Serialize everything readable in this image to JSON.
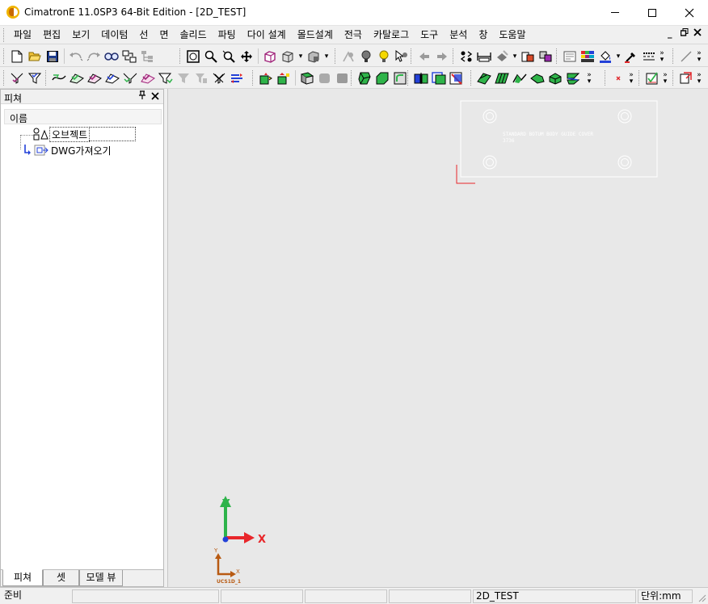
{
  "window": {
    "title": "CimatronE 11.0SP3 64-Bit Edition - [2D_TEST]",
    "controls": [
      "minimize",
      "maximize",
      "close"
    ]
  },
  "menu": {
    "items": [
      "파일",
      "편집",
      "보기",
      "데이텀",
      "선",
      "면",
      "솔리드",
      "파팅",
      "다이 설계",
      "몰드설계",
      "전극",
      "카탈로그",
      "도구",
      "분석",
      "창",
      "도움말"
    ]
  },
  "panel": {
    "title": "피쳐",
    "column_header": "이름",
    "tree": [
      {
        "label": "오브젝트",
        "icon": "objects-icon",
        "selected": true
      },
      {
        "label": "DWG가져오기",
        "icon": "dwg-import-icon",
        "selected": false
      }
    ],
    "tabs": [
      {
        "label": "피쳐",
        "active": true
      },
      {
        "label": "셋",
        "active": false
      },
      {
        "label": "모델 뷰",
        "active": false
      }
    ]
  },
  "viewport": {
    "drawing_text_line1": "STANDARD BOTUM BODY GUIDE COVER",
    "drawing_text_line2": "3736",
    "axis_x": "X",
    "axis_y": "Y",
    "ucs_x": "X",
    "ucs_y": "Y",
    "ucs_label": "UCS1D_1",
    "colors": {
      "x_axis": "#e8262a",
      "y_axis": "#2db34a",
      "ucs": "#b85a12",
      "background": "#e8e8e8"
    }
  },
  "status": {
    "ready": "준비",
    "document": "2D_TEST",
    "units": "단위:mm"
  }
}
